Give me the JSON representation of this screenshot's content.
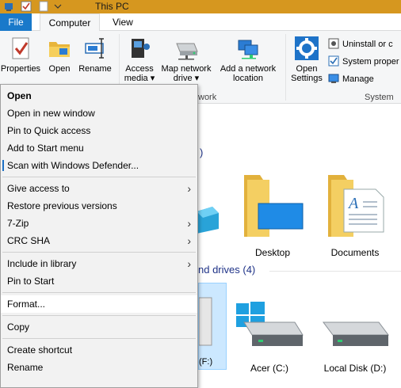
{
  "window": {
    "title": "This PC"
  },
  "tabs": {
    "file": "File",
    "computer": "Computer",
    "view": "View"
  },
  "ribbon": {
    "properties": "Properties",
    "open": "Open",
    "rename": "Rename",
    "access_media_1": "Access",
    "access_media_2": "media",
    "map_drive_1": "Map network",
    "map_drive_2": "drive",
    "add_location_1": "Add a network",
    "add_location_2": "location",
    "open_settings_1": "Open",
    "open_settings_2": "Settings",
    "uninstall": "Uninstall or c",
    "system_properties": "System proper",
    "manage": "Manage",
    "group_network": "work",
    "group_system": "System"
  },
  "content": {
    "folders_suffix": ")",
    "devices_header": "nd drives (4)",
    "desktop": "Desktop",
    "documents": "Documents",
    "drive_f": "(F:)",
    "acer": "Acer (C:)",
    "local_disk": "Local Disk (D:)"
  },
  "menu": {
    "open": "Open",
    "open_new_window": "Open in new window",
    "pin_quick_access": "Pin to Quick access",
    "add_start_menu": "Add to Start menu",
    "scan_defender": "Scan with Windows Defender...",
    "give_access": "Give access to",
    "restore_versions": "Restore previous versions",
    "seven_zip": "7-Zip",
    "crc_sha": "CRC SHA",
    "include_library": "Include in library",
    "pin_start": "Pin to Start",
    "format": "Format...",
    "copy": "Copy",
    "create_shortcut": "Create shortcut",
    "rename": "Rename"
  },
  "colors": {
    "file_tab": "#1979ca",
    "titlebar": "#d6971f",
    "folder": "#f2c94c",
    "header_text": "#1e3287"
  }
}
